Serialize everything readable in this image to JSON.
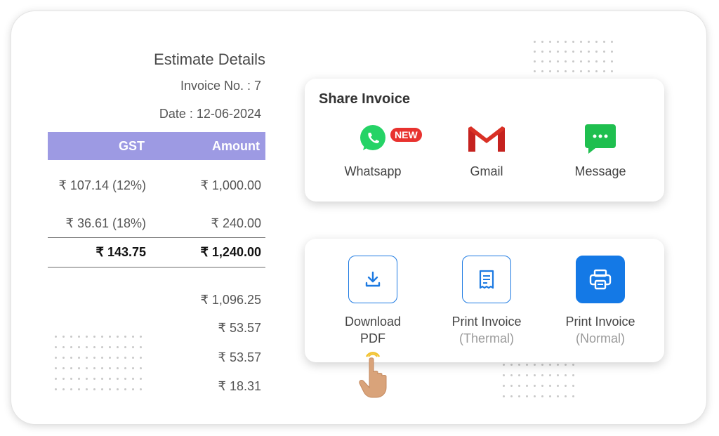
{
  "estimate": {
    "title": "Estimate Details",
    "invoice_no": "Invoice No. : 7",
    "date": "Date : 12-06-2024"
  },
  "table": {
    "headers": {
      "gst": "GST",
      "amount": "Amount"
    },
    "rows": [
      {
        "gst": "₹ 107.14 (12%)",
        "amount": "₹ 1,000.00"
      },
      {
        "gst": "₹ 36.61 (18%)",
        "amount": "₹ 240.00"
      }
    ],
    "total": {
      "gst": "₹ 143.75",
      "amount": "₹ 1,240.00"
    },
    "summary": [
      "₹ 1,096.25",
      "₹ 53.57",
      "₹ 53.57",
      "₹ 18.31"
    ],
    "header_color": "#9d9ae3"
  },
  "share": {
    "title": "Share Invoice",
    "options": [
      {
        "label": "Whatsapp",
        "icon": "whatsapp-icon",
        "badge": "NEW"
      },
      {
        "label": "Gmail",
        "icon": "gmail-icon"
      },
      {
        "label": "Message",
        "icon": "message-icon"
      }
    ]
  },
  "actions": [
    {
      "label": "Download",
      "label2": "PDF",
      "icon": "download-icon"
    },
    {
      "label": "Print Invoice",
      "sub": "(Thermal)",
      "icon": "receipt-icon"
    },
    {
      "label": "Print Invoice",
      "sub": "(Normal)",
      "icon": "printer-icon"
    }
  ],
  "colors": {
    "accent": "#1479e6",
    "whatsapp": "#25d366",
    "gmail_red": "#d93025",
    "message_green": "#1fbf4f"
  }
}
